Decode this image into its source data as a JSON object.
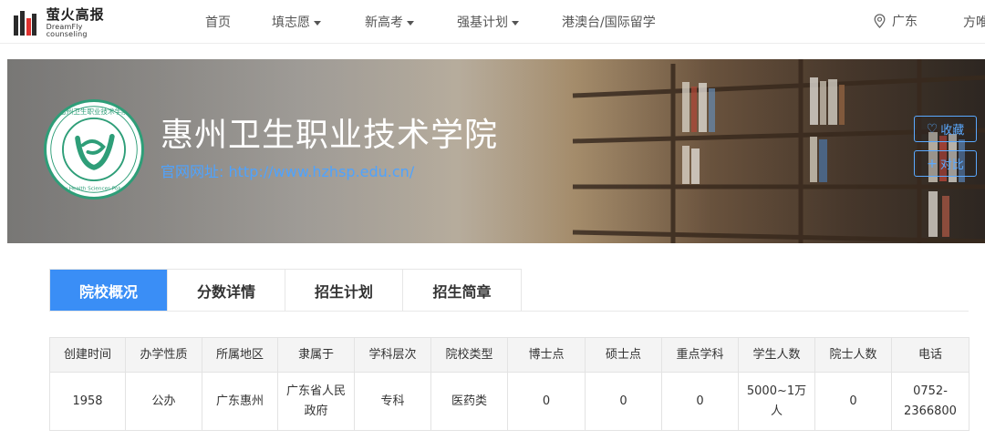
{
  "logo": {
    "cn": "萤火高报",
    "en": "DreamFly counseling"
  },
  "nav": {
    "items": [
      {
        "label": "首页",
        "dropdown": false
      },
      {
        "label": "填志愿",
        "dropdown": true
      },
      {
        "label": "新高考",
        "dropdown": true
      },
      {
        "label": "强基计划",
        "dropdown": true
      },
      {
        "label": "港澳台/国际留学",
        "dropdown": false
      }
    ],
    "location": "广东",
    "user": "方唯"
  },
  "school": {
    "name": "惠州卫生职业技术学院",
    "website_label": "官网网址:",
    "website_url": "http://www.hzhsp.edu.cn/",
    "logo_text_cn": "惠州卫生职业技术学院",
    "logo_text_en": "Huizhou Health Sciences Polytechnic",
    "logo_color": "#2e9e78"
  },
  "actions": {
    "favorite": "收藏",
    "compare": "对比"
  },
  "tabs": [
    {
      "label": "院校概况",
      "active": true
    },
    {
      "label": "分数详情",
      "active": false
    },
    {
      "label": "招生计划",
      "active": false
    },
    {
      "label": "招生简章",
      "active": false
    }
  ],
  "table": {
    "headers": [
      "创建时间",
      "办学性质",
      "所属地区",
      "隶属于",
      "学科层次",
      "院校类型",
      "博士点",
      "硕士点",
      "重点学科",
      "学生人数",
      "院士人数",
      "电话"
    ],
    "row": [
      "1958",
      "公办",
      "广东惠州",
      "广东省人民政府",
      "专科",
      "医药类",
      "0",
      "0",
      "0",
      "5000~1万人",
      "0",
      "0752-2366800"
    ]
  },
  "colors": {
    "accent": "#3a8ef6",
    "link": "#4ea3ff",
    "brand_red": "#e0322f"
  }
}
